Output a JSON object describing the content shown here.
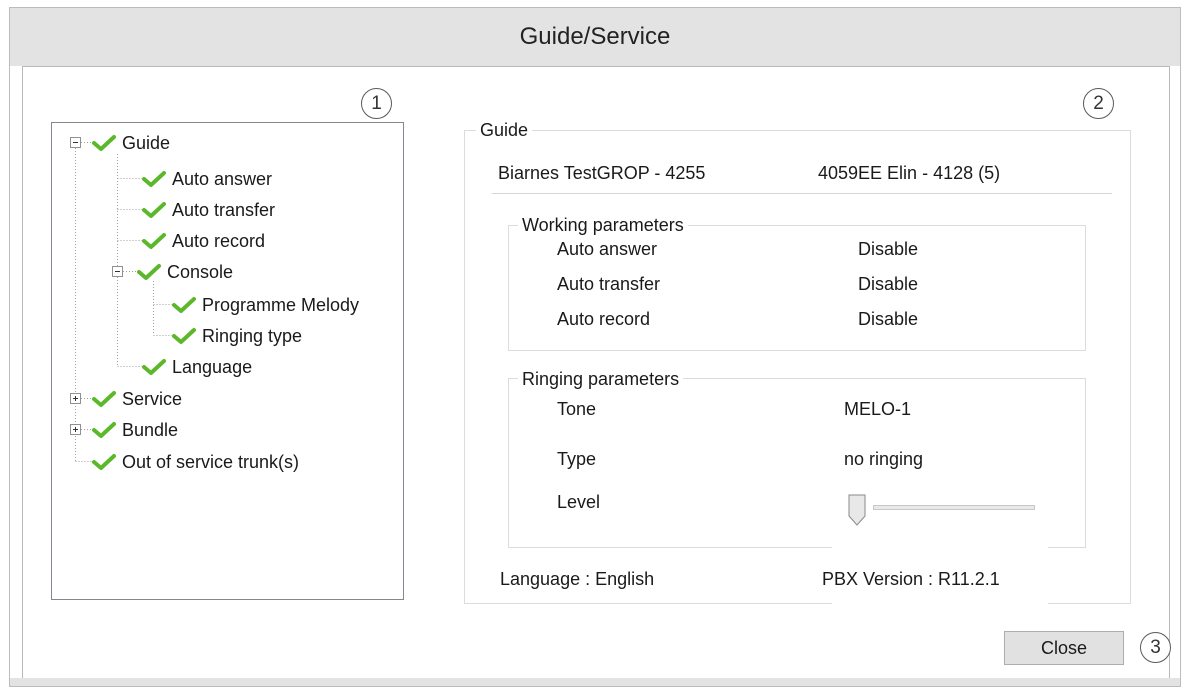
{
  "window": {
    "title": "Guide/Service"
  },
  "callouts": {
    "tree": "1",
    "details": "2",
    "close": "3"
  },
  "tree": {
    "nodes": [
      {
        "label": "Guide",
        "expander": "minus"
      },
      {
        "label": "Auto answer"
      },
      {
        "label": "Auto transfer"
      },
      {
        "label": "Auto record"
      },
      {
        "label": "Console",
        "expander": "minus"
      },
      {
        "label": "Programme Melody"
      },
      {
        "label": "Ringing type"
      },
      {
        "label": "Language"
      },
      {
        "label": "Service",
        "expander": "plus"
      },
      {
        "label": "Bundle",
        "expander": "plus"
      },
      {
        "label": "Out of service trunk(s)"
      }
    ]
  },
  "details": {
    "group_title": "Guide",
    "header_left": "Biarnes TestGROP - 4255",
    "header_right": "4059EE Elin - 4128 (5)",
    "working": {
      "title": "Working parameters",
      "rows": [
        {
          "label": "Auto answer",
          "value": "Disable"
        },
        {
          "label": "Auto transfer",
          "value": "Disable"
        },
        {
          "label": "Auto record",
          "value": "Disable"
        }
      ]
    },
    "ringing": {
      "title": "Ringing parameters",
      "tone_label": "Tone",
      "tone_value": "MELO-1",
      "type_label": "Type",
      "type_value": "no ringing",
      "level_label": "Level",
      "level_fraction": 0
    },
    "footer_left": "Language : English",
    "footer_right": "PBX Version : R11.2.1"
  },
  "buttons": {
    "close": "Close"
  },
  "colors": {
    "check_green": "#5cb82b",
    "title_bar": "#e3e3e3"
  }
}
